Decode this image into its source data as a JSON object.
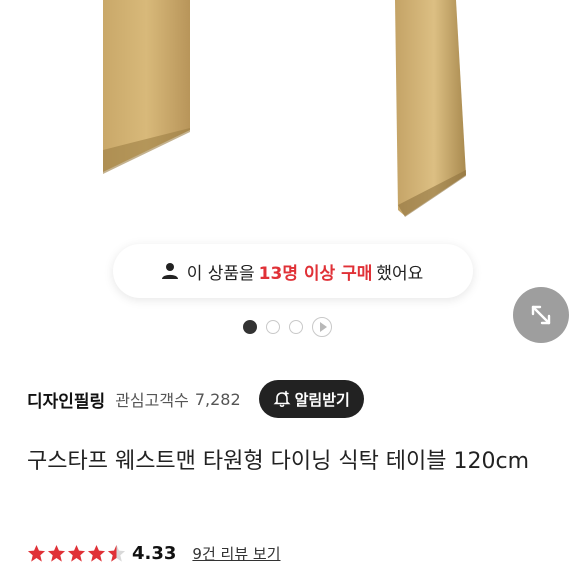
{
  "hero": {
    "image_icon": "table-legs-photo"
  },
  "badge": {
    "icon": "person-icon",
    "prefix": "이 상품을",
    "highlight": "13명 이상 구매",
    "suffix": "했어요",
    "highlight_color": "#e03137"
  },
  "carousel": {
    "count": 4,
    "active_index": 0,
    "has_video": true
  },
  "expand_button": {
    "icon": "expand-arrows-icon"
  },
  "brand": {
    "name": "디자인필링",
    "fav_label": "관심고객수",
    "fav_count": "7,282",
    "alarm_label": "알림받기",
    "alarm_icon": "bell-plus-icon"
  },
  "product": {
    "title": "구스타프 웨스트맨 타원형 다이닝 식탁 테이블 120cm"
  },
  "rating": {
    "stars": 4.5,
    "value": "4.33",
    "review_link": "9건 리뷰 보기",
    "star_color": "#e03137"
  }
}
